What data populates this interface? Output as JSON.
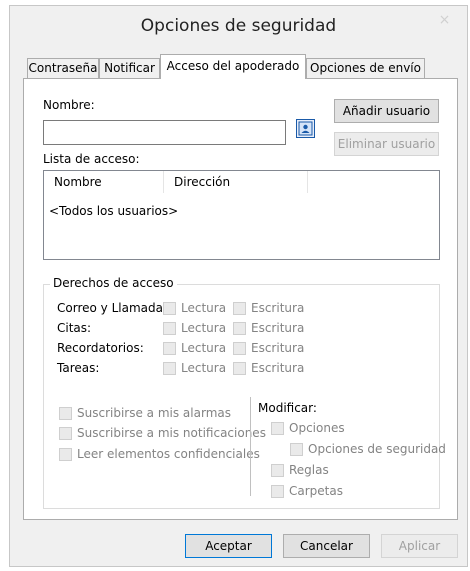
{
  "window": {
    "title": "Opciones de seguridad",
    "close_glyph": "×"
  },
  "tabs": [
    {
      "label": "Contraseña"
    },
    {
      "label": "Notificar"
    },
    {
      "label": "Acceso del apoderado"
    },
    {
      "label": "Opciones de envío"
    }
  ],
  "name_section": {
    "label": "Nombre:",
    "value": "",
    "add_user": "Añadir usuario",
    "remove_user": "Eliminar usuario",
    "address_book_icon": "address-book-icon"
  },
  "access_list": {
    "label": "Lista de acceso:",
    "columns": [
      "Nombre",
      "Dirección"
    ],
    "rows": [
      "<Todos los usuarios>"
    ]
  },
  "rights": {
    "legend": "Derechos de acceso",
    "rows": [
      {
        "label": "Correo y Llamada:",
        "read": "Lectura",
        "write": "Escritura"
      },
      {
        "label": "Citas:",
        "read": "Lectura",
        "write": "Escritura"
      },
      {
        "label": "Recordatorios:",
        "read": "Lectura",
        "write": "Escritura"
      },
      {
        "label": "Tareas:",
        "read": "Lectura",
        "write": "Escritura"
      }
    ],
    "left_checks": [
      "Suscribirse a mis alarmas",
      "Suscribirse a mis notificaciones",
      "Leer elementos confidenciales"
    ],
    "modify": {
      "label": "Modificar:",
      "options": "Opciones",
      "security_options": "Opciones de seguridad",
      "rules": "Reglas",
      "folders": "Carpetas"
    }
  },
  "footer": {
    "ok": "Aceptar",
    "cancel": "Cancelar",
    "apply": "Aplicar"
  },
  "colors": {
    "accent": "#0078d7",
    "disabled_text": "#838383"
  }
}
